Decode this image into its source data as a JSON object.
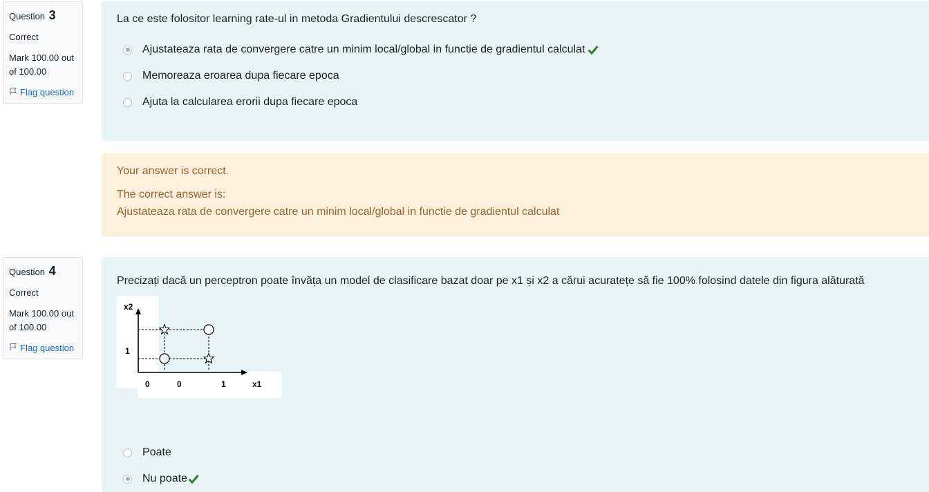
{
  "questions": [
    {
      "label": "Question",
      "number": "3",
      "state": "Correct",
      "grade": "Mark 100.00 out of 100.00",
      "flag_label": "Flag question",
      "text": "La ce este folositor learning rate-ul in metoda Gradientului descrescator ?",
      "options": [
        {
          "text": "Ajustateaza rata de convergere catre un minim local/global in functie de gradientul calculat",
          "selected": true,
          "correct_mark": true
        },
        {
          "text": "Memoreaza eroarea dupa fiecare epoca",
          "selected": false,
          "correct_mark": false
        },
        {
          "text": "Ajuta la calcularea erorii dupa fiecare epoca",
          "selected": false,
          "correct_mark": false
        }
      ],
      "feedback": {
        "result": "Your answer is correct.",
        "correct_intro": "The correct answer is:",
        "correct_answer": "Ajustateaza rata de convergere catre un minim local/global in functie de gradientul calculat"
      }
    },
    {
      "label": "Question",
      "number": "4",
      "state": "Correct",
      "grade": "Mark 100.00 out of 100.00",
      "flag_label": "Flag question",
      "text": "Precizați dacă un perceptron poate învăța un model de clasificare bazat doar pe x1 și x2 a cărui acuratețe să fie 100% folosind datele din figura alăturată",
      "figure": {
        "y_axis_label": "x2",
        "x_axis_label": "x1",
        "y_tick": "1",
        "x_ticks": [
          "0",
          "0",
          "1"
        ],
        "points": [
          {
            "x": 0,
            "y": 0,
            "shape": "circle"
          },
          {
            "x": 0,
            "y": 1,
            "shape": "star"
          },
          {
            "x": 1,
            "y": 0,
            "shape": "star"
          },
          {
            "x": 1,
            "y": 1,
            "shape": "circle"
          }
        ]
      },
      "options": [
        {
          "text": "Poate",
          "selected": false,
          "correct_mark": false
        },
        {
          "text": "Nu poate",
          "selected": true,
          "correct_mark": true
        }
      ]
    }
  ],
  "colors": {
    "formulation_bg": "#e7f3f5",
    "feedback_bg": "#fcefdc",
    "feedback_text": "#8e662e",
    "link": "#0f6cbf",
    "check_green": "#357a32"
  }
}
